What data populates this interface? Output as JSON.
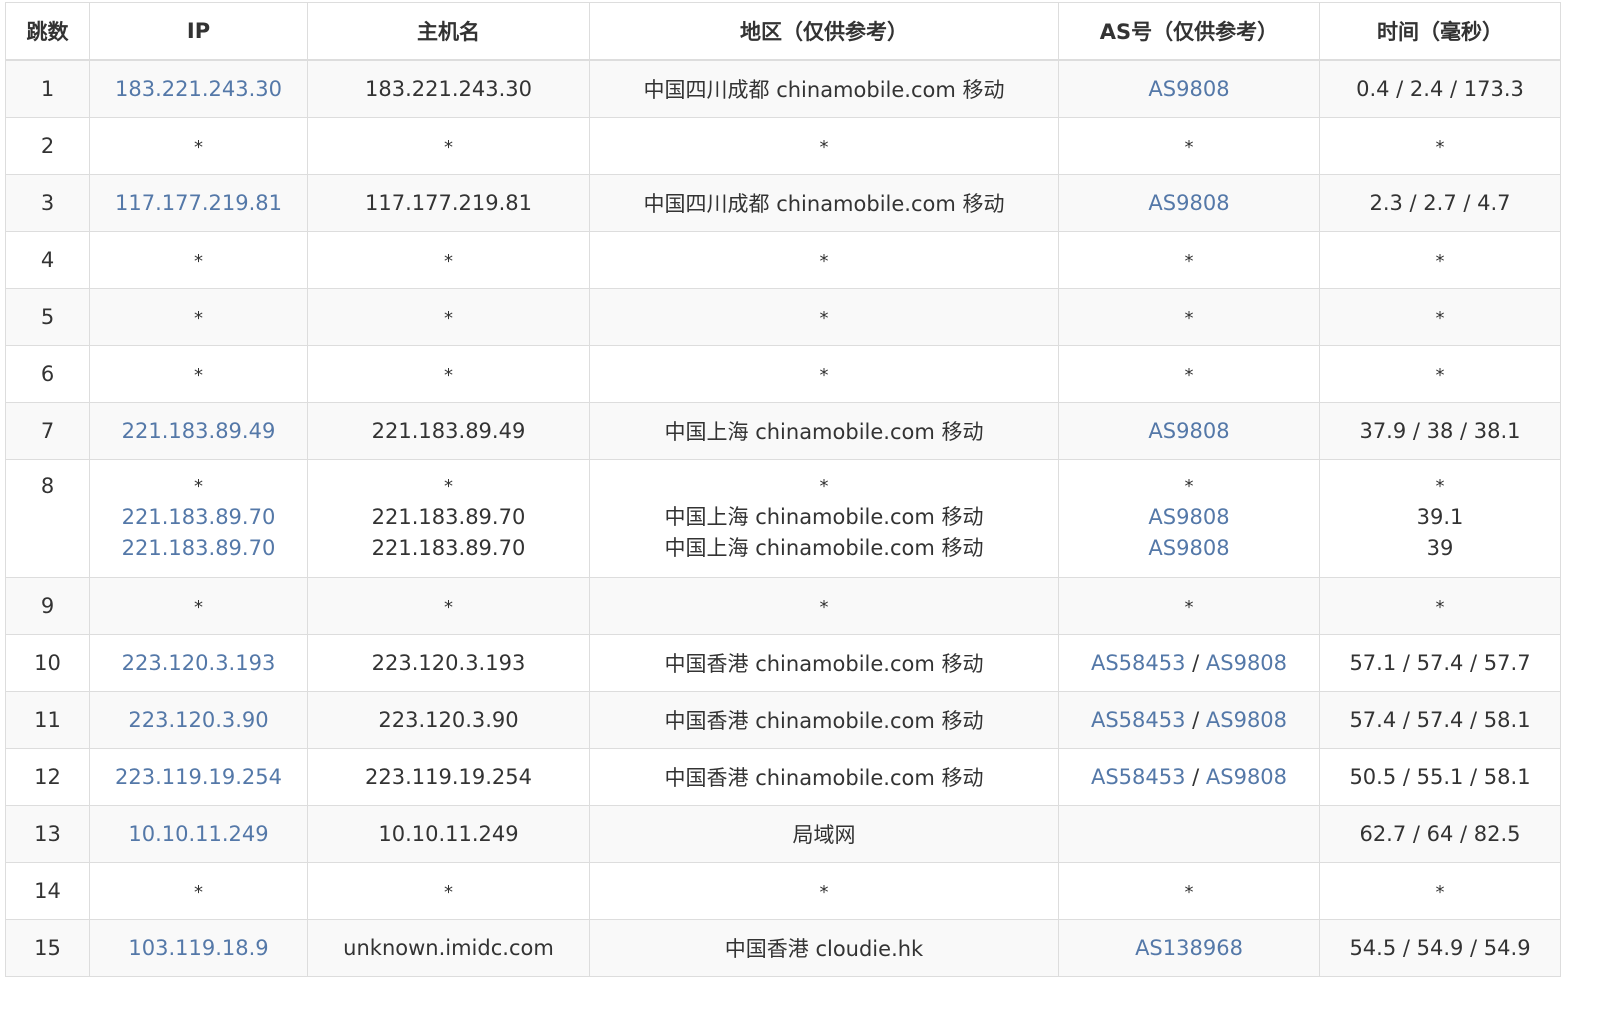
{
  "colors": {
    "link": "#5478a8",
    "text": "#333333",
    "border": "#dddddd",
    "stripe": "#f9f9f9"
  },
  "headers": [
    "跳数",
    "IP",
    "主机名",
    "地区（仅供参考）",
    "AS号（仅供参考）",
    "时间（毫秒）"
  ],
  "rows": [
    {
      "hop": "1",
      "ip": "183.221.243.30",
      "host": "183.221.243.30",
      "region": "中国四川成都 chinamobile.com 移动",
      "as1": "AS9808",
      "as2": "",
      "time": "0.4 / 2.4 / 173.3"
    },
    {
      "hop": "2",
      "ip": "*",
      "host": "*",
      "region": "*",
      "as1": "*",
      "as2": "",
      "time": "*"
    },
    {
      "hop": "3",
      "ip": "117.177.219.81",
      "host": "117.177.219.81",
      "region": "中国四川成都 chinamobile.com 移动",
      "as1": "AS9808",
      "as2": "",
      "time": "2.3 / 2.7 / 4.7"
    },
    {
      "hop": "4",
      "ip": "*",
      "host": "*",
      "region": "*",
      "as1": "*",
      "as2": "",
      "time": "*"
    },
    {
      "hop": "5",
      "ip": "*",
      "host": "*",
      "region": "*",
      "as1": "*",
      "as2": "",
      "time": "*"
    },
    {
      "hop": "6",
      "ip": "*",
      "host": "*",
      "region": "*",
      "as1": "*",
      "as2": "",
      "time": "*"
    },
    {
      "hop": "7",
      "ip": "221.183.89.49",
      "host": "221.183.89.49",
      "region": "中国上海 chinamobile.com 移动",
      "as1": "AS9808",
      "as2": "",
      "time": "37.9 / 38 / 38.1"
    }
  ],
  "row8": {
    "hop": "8",
    "lines": [
      {
        "ip": "*",
        "host": "*",
        "region": "*",
        "as": "*",
        "time": "*"
      },
      {
        "ip": "221.183.89.70",
        "host": "221.183.89.70",
        "region": "中国上海 chinamobile.com 移动",
        "as": "AS9808",
        "time": "39.1"
      },
      {
        "ip": "221.183.89.70",
        "host": "221.183.89.70",
        "region": "中国上海 chinamobile.com 移动",
        "as": "AS9808",
        "time": "39"
      }
    ]
  },
  "rows2": [
    {
      "hop": "9",
      "ip": "*",
      "host": "*",
      "region": "*",
      "as1": "*",
      "as2": "",
      "time": "*"
    },
    {
      "hop": "10",
      "ip": "223.120.3.193",
      "host": "223.120.3.193",
      "region": "中国香港 chinamobile.com 移动",
      "as1": "AS58453",
      "as2": "AS9808",
      "time": "57.1 / 57.4 / 57.7"
    },
    {
      "hop": "11",
      "ip": "223.120.3.90",
      "host": "223.120.3.90",
      "region": "中国香港 chinamobile.com 移动",
      "as1": "AS58453",
      "as2": "AS9808",
      "time": "57.4 / 57.4 / 58.1"
    },
    {
      "hop": "12",
      "ip": "223.119.19.254",
      "host": "223.119.19.254",
      "region": "中国香港 chinamobile.com 移动",
      "as1": "AS58453",
      "as2": "AS9808",
      "time": "50.5 / 55.1 / 58.1"
    },
    {
      "hop": "13",
      "ip": "10.10.11.249",
      "host": "10.10.11.249",
      "region": "局域网",
      "as1": "",
      "as2": "",
      "time": "62.7 / 64 / 82.5"
    },
    {
      "hop": "14",
      "ip": "*",
      "host": "*",
      "region": "*",
      "as1": "*",
      "as2": "",
      "time": "*"
    },
    {
      "hop": "15",
      "ip": "103.119.18.9",
      "host": "unknown.imidc.com",
      "region": "中国香港 cloudie.hk",
      "as1": "AS138968",
      "as2": "",
      "time": "54.5 / 54.9 / 54.9"
    }
  ],
  "as_separator": " / "
}
